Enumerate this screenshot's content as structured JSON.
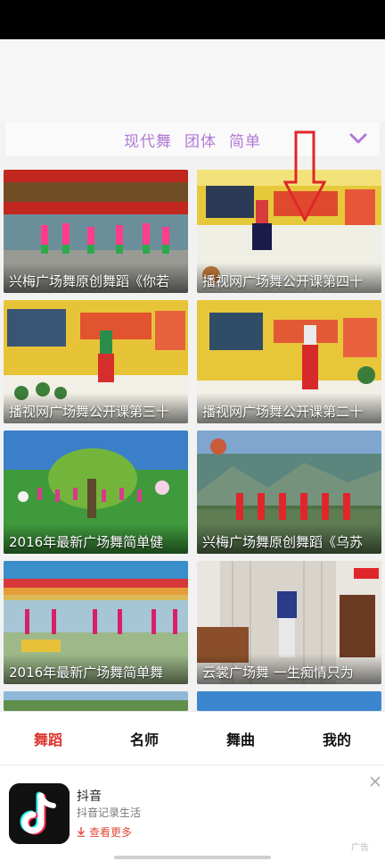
{
  "filters": {
    "tags": [
      "现代舞",
      "团体",
      "简单"
    ],
    "accent_color": "#b07ad6"
  },
  "videos": [
    {
      "title": "兴梅广场舞原创舞蹈《你若"
    },
    {
      "title": "播视网广场舞公开课第四十"
    },
    {
      "title": "播视网广场舞公开课第三十"
    },
    {
      "title": "播视网广场舞公开课第二十"
    },
    {
      "title": "2016年最新广场舞简单健"
    },
    {
      "title": "兴梅广场舞原创舞蹈《乌苏"
    },
    {
      "title": "2016年最新广场舞简单舞"
    },
    {
      "title": "云裳广场舞 一生痴情只为"
    }
  ],
  "tabs": [
    {
      "label": "舞蹈",
      "active": true
    },
    {
      "label": "名师",
      "active": false
    },
    {
      "label": "舞曲",
      "active": false
    },
    {
      "label": "我的",
      "active": false
    }
  ],
  "ad": {
    "app_name": "抖音",
    "slogan": "抖音记录生活",
    "more_label": "查看更多",
    "ad_tag": "广告"
  },
  "colors": {
    "active_tab": "#d9342b",
    "annotation_arrow": "#e0262a"
  }
}
